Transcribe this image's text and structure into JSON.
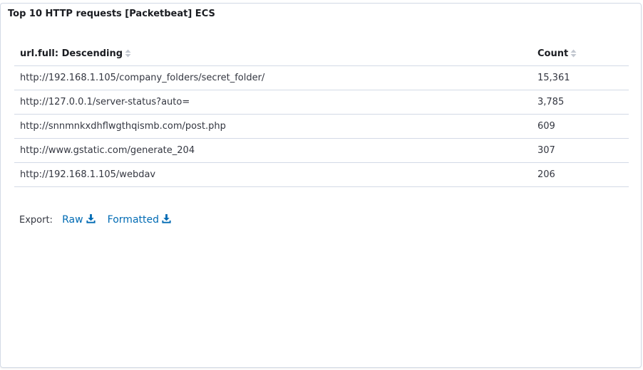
{
  "panel": {
    "title": "Top 10 HTTP requests [Packetbeat] ECS"
  },
  "table": {
    "columns": [
      {
        "label": "url.full: Descending",
        "sort_icon": "sort-icon"
      },
      {
        "label": "Count",
        "sort_icon": "sort-icon"
      }
    ],
    "rows": [
      {
        "url": "http://192.168.1.105/company_folders/secret_folder/",
        "count": "15,361"
      },
      {
        "url": "http://127.0.0.1/server-status?auto=",
        "count": "3,785"
      },
      {
        "url": "http://snnmnkxdhflwgthqismb.com/post.php",
        "count": "609"
      },
      {
        "url": "http://www.gstatic.com/generate_204",
        "count": "307"
      },
      {
        "url": "http://192.168.1.105/webdav",
        "count": "206"
      }
    ]
  },
  "export": {
    "label": "Export:",
    "raw_label": "Raw",
    "formatted_label": "Formatted",
    "icon": "download-icon"
  },
  "colors": {
    "link": "#006bb4",
    "text": "#343741",
    "border": "#d3dae6",
    "heading": "#1a1c21"
  }
}
